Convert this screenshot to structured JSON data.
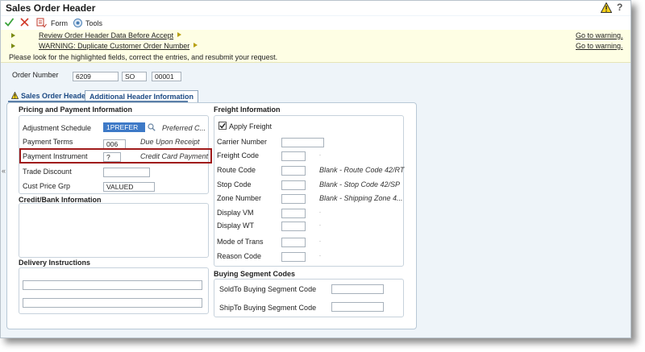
{
  "title": "Sales Order Header",
  "toolbar": {
    "form_label": "Form",
    "tools_label": "Tools"
  },
  "messages": {
    "items": [
      {
        "text": "Review Order Header Data Before Accept",
        "action": "Go to warning."
      },
      {
        "text": "WARNING: Duplicate Customer Order Number",
        "action": "Go to warning."
      }
    ],
    "resubmit": "Please look for the highlighted fields, correct the entries, and resubmit your request."
  },
  "order": {
    "label": "Order Number",
    "number": "6209",
    "type": "SO",
    "company": "00001"
  },
  "tabs": [
    {
      "label": "Sales Order Header"
    },
    {
      "label": "Additional Header Information"
    }
  ],
  "pricing": {
    "title": "Pricing and Payment Information",
    "adjustment_schedule": {
      "label": "Adjustment Schedule",
      "value": "1PREFER",
      "desc": "Preferred C..."
    },
    "payment_terms": {
      "label": "Payment Terms",
      "value": "006",
      "desc": "Due Upon Receipt"
    },
    "payment_instrument": {
      "label": "Payment Instrument",
      "value": "?",
      "desc": "Credit Card Payment"
    },
    "trade_discount": {
      "label": "Trade Discount",
      "value": ""
    },
    "cust_price_grp": {
      "label": "Cust Price Grp",
      "value": "VALUED"
    }
  },
  "credit_bank": {
    "title": "Credit/Bank Information"
  },
  "delivery": {
    "title": "Delivery Instructions",
    "line1": "",
    "line2": ""
  },
  "freight": {
    "title": "Freight Information",
    "apply_freight": "Apply Freight",
    "rows": [
      {
        "label": "Carrier Number",
        "value": "",
        "desc": ""
      },
      {
        "label": "Freight Code",
        "value": "",
        "desc": "."
      },
      {
        "label": "Route Code",
        "value": "",
        "desc": "Blank - Route Code 42/RT"
      },
      {
        "label": "Stop Code",
        "value": "",
        "desc": "Blank - Stop Code 42/SP"
      },
      {
        "label": "Zone Number",
        "value": "",
        "desc": "Blank - Shipping Zone 4..."
      },
      {
        "label": "Display VM",
        "value": "",
        "desc": "."
      },
      {
        "label": "Display WT",
        "value": "",
        "desc": "."
      },
      {
        "label": "Mode of Trans",
        "value": "",
        "desc": "."
      },
      {
        "label": "Reason Code",
        "value": "",
        "desc": "."
      }
    ]
  },
  "buying": {
    "title": "Buying Segment Codes",
    "soldto": {
      "label": "SoldTo Buying Segment Code",
      "value": ""
    },
    "shipto": {
      "label": "ShipTo Buying Segment Code",
      "value": ""
    }
  },
  "icons": {
    "warning": "warning-triangle-icon",
    "help": "help-icon",
    "ok": "checkmark-icon",
    "cancel": "close-icon",
    "form": "form-menu-icon",
    "tools": "tools-gear-icon",
    "lookup": "search-icon",
    "collapse": "double-chevron-left-icon"
  },
  "colors": {
    "highlight": "#a01a1a",
    "tab_text": "#1c4a84",
    "message_bg": "#fefee4"
  }
}
